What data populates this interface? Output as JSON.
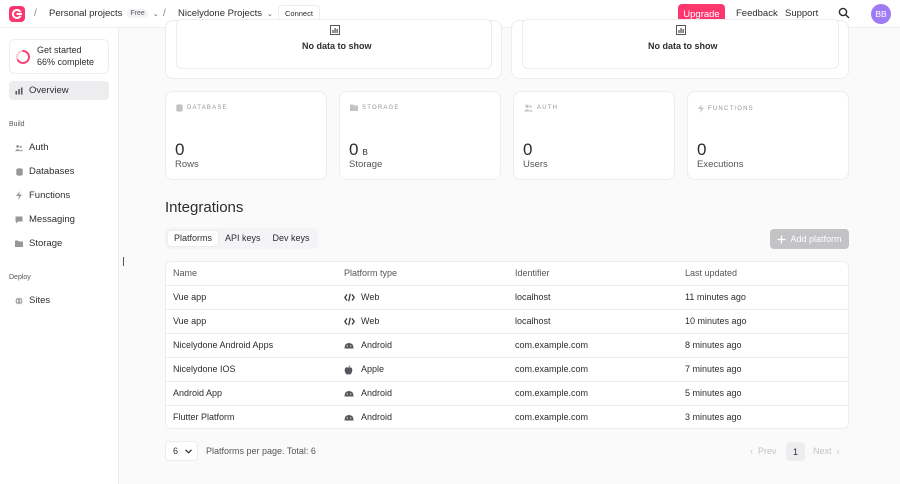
{
  "header": {
    "breadcrumb": [
      {
        "label": "Personal projects",
        "badge": "Free"
      },
      {
        "label": "Nicelydone Projects"
      }
    ],
    "separator": "/",
    "connect_label": "Connect",
    "upgrade_label": "Upgrade",
    "feedback_label": "Feedback",
    "support_label": "Support",
    "avatar_initials": "BB"
  },
  "sidebar": {
    "progress": {
      "title": "Get started",
      "subtitle": "66% complete",
      "value": 0.66
    },
    "overview_label": "Overview",
    "build_heading": "Build",
    "build_items": [
      "Auth",
      "Databases",
      "Functions",
      "Messaging",
      "Storage"
    ],
    "deploy_heading": "Deploy",
    "deploy_items": [
      "Sites"
    ]
  },
  "charts": {
    "left_empty": "No data to show",
    "right_empty": "No data to show"
  },
  "stats": [
    {
      "label": "DATABASE",
      "value": "0",
      "unit": "",
      "caption": "Rows",
      "icon": "database-icon"
    },
    {
      "label": "STORAGE",
      "value": "0",
      "unit": "B",
      "caption": "Storage",
      "icon": "folder-icon"
    },
    {
      "label": "AUTH",
      "value": "0",
      "unit": "",
      "caption": "Users",
      "icon": "users-icon"
    },
    {
      "label": "FUNCTIONS",
      "value": "0",
      "unit": "",
      "caption": "Executions",
      "icon": "lightning-icon"
    }
  ],
  "integrations": {
    "title": "Integrations",
    "tabs": [
      "Platforms",
      "API keys",
      "Dev keys"
    ],
    "active_tab": 0,
    "add_label": "Add platform",
    "columns": [
      "Name",
      "Platform type",
      "Identifier",
      "Last updated"
    ],
    "rows": [
      {
        "name": "Vue app",
        "type": "Web",
        "icon": "code-icon",
        "identifier": "localhost",
        "updated": "11 minutes ago"
      },
      {
        "name": "Vue app",
        "type": "Web",
        "icon": "code-icon",
        "identifier": "localhost",
        "updated": "10 minutes ago"
      },
      {
        "name": "Nicelydone Android Apps",
        "type": "Android",
        "icon": "android-icon",
        "identifier": "com.example.com",
        "updated": "8 minutes ago"
      },
      {
        "name": "Nicelydone IOS",
        "type": "Apple",
        "icon": "apple-icon",
        "identifier": "com.example.com",
        "updated": "7 minutes ago"
      },
      {
        "name": "Android App",
        "type": "Android",
        "icon": "android-icon",
        "identifier": "com.example.com",
        "updated": "5 minutes ago"
      },
      {
        "name": "Flutter Platform",
        "type": "Android",
        "icon": "android-icon",
        "identifier": "com.example.com",
        "updated": "3 minutes ago"
      }
    ]
  },
  "pagination": {
    "per_page": "6",
    "summary": "Platforms per page. Total: 6",
    "prev_label": "Prev",
    "current_page": "1",
    "next_label": "Next"
  },
  "colors": {
    "brand": "#fd366e",
    "avatar": "#9f7cf4",
    "disabled": "#c3c3c6"
  }
}
